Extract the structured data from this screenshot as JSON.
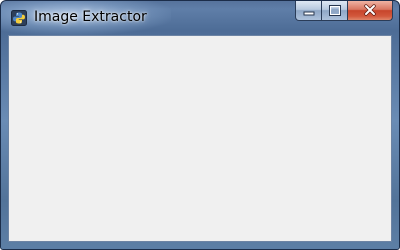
{
  "window": {
    "title": "Image Extractor",
    "app_icon": "python-icon",
    "controls": {
      "minimize_icon": "minimize-icon",
      "maximize_icon": "maximize-icon",
      "close_icon": "close-icon"
    }
  },
  "colors": {
    "frame": "#5f7ea8",
    "client_background": "#f0f0f0",
    "close_button": "#c7452b"
  }
}
